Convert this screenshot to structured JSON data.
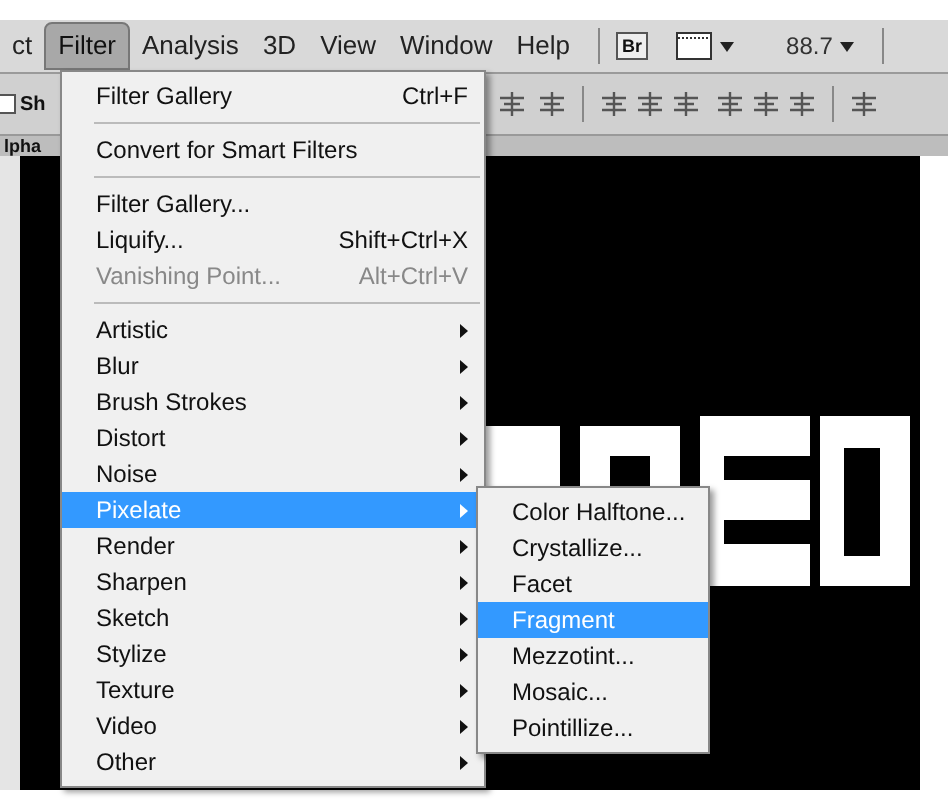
{
  "menu_bar": [
    {
      "label": "ct",
      "selected": false
    },
    {
      "label": "Filter",
      "selected": true
    },
    {
      "label": "Analysis",
      "selected": false
    },
    {
      "label": "3D",
      "selected": false
    },
    {
      "label": "View",
      "selected": false
    },
    {
      "label": "Window",
      "selected": false
    },
    {
      "label": "Help",
      "selected": false
    }
  ],
  "zoom": "88.7",
  "bridge_button": "Br",
  "options_bar": {
    "checkbox_label": "Sh",
    "checked": false
  },
  "doc_tab": "lpha",
  "filter_menu": [
    {
      "kind": "item",
      "label": "Filter Gallery",
      "shortcut": "Ctrl+F",
      "disabled": false,
      "selected": false
    },
    {
      "kind": "separator"
    },
    {
      "kind": "item",
      "label": "Convert for Smart Filters",
      "disabled": false,
      "selected": false
    },
    {
      "kind": "separator"
    },
    {
      "kind": "item",
      "label": "Filter Gallery...",
      "disabled": false,
      "selected": false
    },
    {
      "kind": "item",
      "label": "Liquify...",
      "shortcut": "Shift+Ctrl+X",
      "disabled": false,
      "selected": false
    },
    {
      "kind": "item",
      "label": "Vanishing Point...",
      "shortcut": "Alt+Ctrl+V",
      "disabled": true,
      "selected": false
    },
    {
      "kind": "separator"
    },
    {
      "kind": "submenu",
      "label": "Artistic",
      "selected": false
    },
    {
      "kind": "submenu",
      "label": "Blur",
      "selected": false
    },
    {
      "kind": "submenu",
      "label": "Brush Strokes",
      "selected": false
    },
    {
      "kind": "submenu",
      "label": "Distort",
      "selected": false
    },
    {
      "kind": "submenu",
      "label": "Noise",
      "selected": false
    },
    {
      "kind": "submenu",
      "label": "Pixelate",
      "selected": true
    },
    {
      "kind": "submenu",
      "label": "Render",
      "selected": false
    },
    {
      "kind": "submenu",
      "label": "Sharpen",
      "selected": false
    },
    {
      "kind": "submenu",
      "label": "Sketch",
      "selected": false
    },
    {
      "kind": "submenu",
      "label": "Stylize",
      "selected": false
    },
    {
      "kind": "submenu",
      "label": "Texture",
      "selected": false
    },
    {
      "kind": "submenu",
      "label": "Video",
      "selected": false
    },
    {
      "kind": "submenu",
      "label": "Other",
      "selected": false
    }
  ],
  "pixelate_submenu": [
    {
      "label": "Color Halftone...",
      "selected": false
    },
    {
      "label": "Crystallize...",
      "selected": false
    },
    {
      "label": "Facet",
      "selected": false
    },
    {
      "label": "Fragment",
      "selected": true
    },
    {
      "label": "Mezzotint...",
      "selected": false
    },
    {
      "label": "Mosaic...",
      "selected": false
    },
    {
      "label": "Pointillize...",
      "selected": false
    }
  ]
}
